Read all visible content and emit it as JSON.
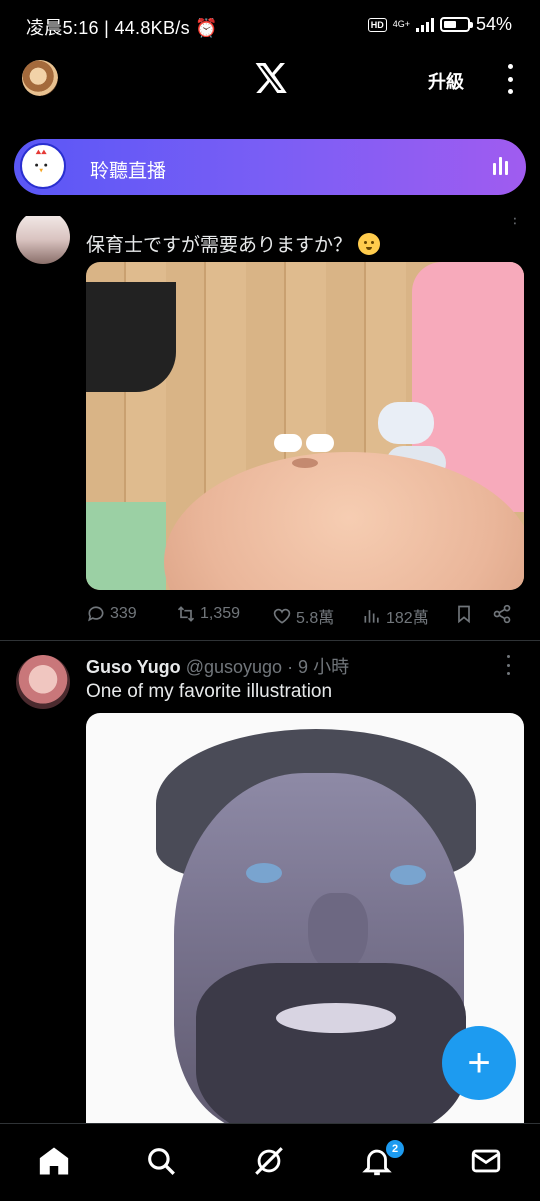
{
  "status_bar": {
    "time": "凌晨5:16",
    "speed": "44.8KB/s",
    "hd": "HD",
    "network": "4G+",
    "battery": "54%",
    "battery_level": 0.54
  },
  "header": {
    "upgrade_label": "升級",
    "logo": "x-logo",
    "more": "more-vertical-icon"
  },
  "live_banner": {
    "label": "聆聽直播"
  },
  "tweets": [
    {
      "author": "",
      "handle": "",
      "text": "保育士ですが需要ありますか？",
      "emoji": "baby-emoji",
      "replies": "339",
      "retweets": "1,359",
      "likes": "5.8萬",
      "views": "182萬"
    },
    {
      "author": "Guso Yugo",
      "handle": "@gusoyugo",
      "time": "· 9 小時",
      "text": "One of my favorite illustration"
    }
  ],
  "fab": {
    "label": "+"
  },
  "bottom_nav": {
    "items": [
      "home-icon",
      "search-icon",
      "grok-icon",
      "notifications-icon",
      "messages-icon"
    ],
    "notification_count": "2"
  },
  "colors": {
    "accent": "#1d9bf0",
    "live_gradient_start": "#5a57f6",
    "live_gradient_end": "#a05cf0",
    "muted_text": "#71767b"
  }
}
